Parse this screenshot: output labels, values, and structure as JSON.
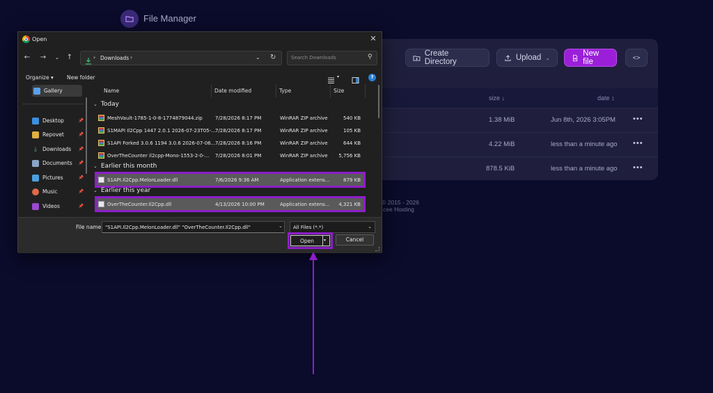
{
  "app": {
    "title": "File Manager",
    "toolbar": {
      "create_directory": "Create Directory",
      "upload": "Upload",
      "new_file": "New file",
      "code_toggle": "<>"
    },
    "table": {
      "headers": {
        "size": "size ↓",
        "date": "date ↕"
      },
      "rows": [
        {
          "size": "1.38 MiB",
          "date": "Jun 8th, 2026 3:05PM"
        },
        {
          "size": "4.22 MiB",
          "date": "less than a minute ago"
        },
        {
          "size": "878.5 KiB",
          "date": "less than a minute ago"
        }
      ],
      "row_menu": "•••"
    },
    "footer": {
      "line1": "© 2015 - 2026",
      "line2": "cee Hosting"
    },
    "accent_color": "#9b1fd9"
  },
  "dialog": {
    "title": "Open",
    "address": {
      "folder": "Downloads",
      "separator": "›"
    },
    "search_placeholder": "Search Downloads",
    "commands": {
      "organize": "Organize ▾",
      "new_folder": "New folder"
    },
    "sidebar": [
      {
        "label": "Gallery",
        "icon": "gallery-icon"
      },
      {
        "label": "Desktop",
        "icon": "desktop-icon"
      },
      {
        "label": "Repovet",
        "icon": "folder-icon"
      },
      {
        "label": "Downloads",
        "icon": "downloads-icon"
      },
      {
        "label": "Documents",
        "icon": "documents-icon"
      },
      {
        "label": "Pictures",
        "icon": "pictures-icon"
      },
      {
        "label": "Music",
        "icon": "music-icon"
      },
      {
        "label": "Videos",
        "icon": "videos-icon"
      }
    ],
    "columns": {
      "name": "Name",
      "date": "Date modified",
      "type": "Type",
      "size": "Size"
    },
    "groups": [
      {
        "label": "Today",
        "files": [
          {
            "name": "MeshVault-1785-1-0-8-1774879044.zip",
            "date": "7/28/2026 8:17 PM",
            "type": "WinRAR ZIP archive",
            "size": "540 KB",
            "icon": "rar-icon"
          },
          {
            "name": "S1MAPI Il2Cpp 1447 2.0.1 2026-07-23T05-...",
            "date": "7/28/2026 8:17 PM",
            "type": "WinRAR ZIP archive",
            "size": "105 KB",
            "icon": "rar-icon"
          },
          {
            "name": "S1API Forked 3.0.6 1194 3.0.6 2026-07-06...",
            "date": "7/28/2026 8:16 PM",
            "type": "WinRAR ZIP archive",
            "size": "644 KB",
            "icon": "rar-icon"
          },
          {
            "name": "OverTheCounter il2cpp-Mono-1553-2-0-...",
            "date": "7/28/2026 8:01 PM",
            "type": "WinRAR ZIP archive",
            "size": "5,756 KB",
            "icon": "rar-icon"
          }
        ]
      },
      {
        "label": "Earlier this month",
        "files": [
          {
            "name": "S1API.Il2Cpp.MelonLoader.dll",
            "date": "7/6/2026 9:36 AM",
            "type": "Application extens...",
            "size": "879 KB",
            "icon": "dll-icon",
            "selected": true
          }
        ]
      },
      {
        "label": "Earlier this year",
        "files": [
          {
            "name": "OverTheCounter.Il2Cpp.dll",
            "date": "4/13/2026 10:00 PM",
            "type": "Application extens...",
            "size": "4,321 KB",
            "icon": "dll-icon",
            "selected": true
          }
        ]
      }
    ],
    "file_name_label": "File name:",
    "file_name_value": "\"S1API.Il2Cpp.MelonLoader.dll\" \"OverTheCounter.Il2Cpp.dll\"",
    "file_type": "All Files (*.*)",
    "open_button": "Open",
    "cancel_button": "Cancel",
    "highlight_color": "#8e1ec9"
  }
}
